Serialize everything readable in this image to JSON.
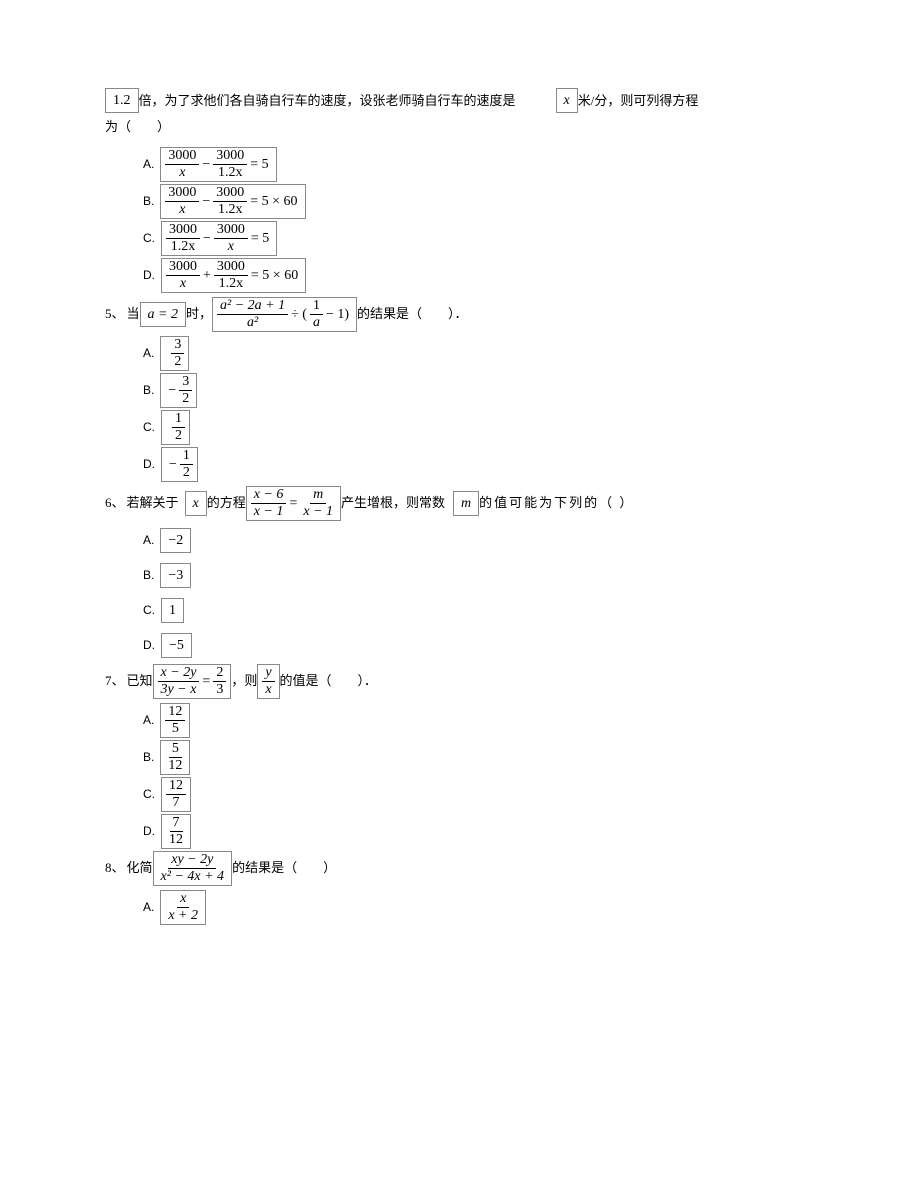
{
  "intro": {
    "prefix": "1.2",
    "t1": "倍，为了求他们各自骑自行车的速度，设张老师骑自行车的速度是",
    "var": "x",
    "t2": "米/分，则可列得方程",
    "t3": "为（　　）"
  },
  "q4opts": {
    "A": {
      "n1": "3000",
      "d1": "x",
      "op": "−",
      "n2": "3000",
      "d2": "1.2x",
      "eq": "= 5"
    },
    "B": {
      "n1": "3000",
      "d1": "x",
      "op": "−",
      "n2": "3000",
      "d2": "1.2x",
      "eq": "= 5 × 60"
    },
    "C": {
      "n1": "3000",
      "d1": "1.2x",
      "op": "−",
      "n2": "3000",
      "d2": "x",
      "eq": "= 5"
    },
    "D": {
      "n1": "3000",
      "d1": "x",
      "op": "+",
      "n2": "3000",
      "d2": "1.2x",
      "eq": "= 5 × 60"
    }
  },
  "q5": {
    "num": "5、",
    "t1": "当",
    "cond": "a = 2",
    "t2": "时，",
    "exprNum": "a² − 2a + 1",
    "exprDen": "a²",
    "div": "÷ (",
    "innerNum": "1",
    "innerDen": "a",
    "after": "− 1)",
    "t3": "的结果是（　　）．",
    "A": {
      "neg": "",
      "n": "3",
      "d": "2"
    },
    "B": {
      "neg": "−",
      "n": "3",
      "d": "2"
    },
    "C": {
      "neg": "",
      "n": "1",
      "d": "2"
    },
    "D": {
      "neg": "−",
      "n": "1",
      "d": "2"
    }
  },
  "q6": {
    "num": "6、",
    "t1": "若解关于",
    "var1": "x",
    "t2": "的方程",
    "ln": "x − 6",
    "ld": "x − 1",
    "eq": "=",
    "rn": "m",
    "rd": "x − 1",
    "t3": "产生增根，则常数",
    "var2": "m",
    "t4": "的值可能为下列的（  ）",
    "A": "−2",
    "B": "−3",
    "C": "1",
    "D": "−5"
  },
  "q7": {
    "num": "7、",
    "t1": "已知",
    "ln": "x − 2y",
    "ld": "3y − x",
    "eq": "=",
    "rn": "2",
    "rd": "3",
    "t2": "，则",
    "vn": "y",
    "vd": "x",
    "t3": "的值是（　　）．",
    "A": {
      "n": "12",
      "d": "5"
    },
    "B": {
      "n": "5",
      "d": "12"
    },
    "C": {
      "n": "12",
      "d": "7"
    },
    "D": {
      "n": "7",
      "d": "12"
    }
  },
  "q8": {
    "num": "8、",
    "t1": "化简",
    "ln": "xy − 2y",
    "ld": "x² − 4x + 4",
    "t2": "的结果是（　　）",
    "A": {
      "n": "x",
      "d": "x + 2"
    }
  },
  "labels": {
    "A": "A.",
    "B": "B.",
    "C": "C.",
    "D": "D."
  }
}
